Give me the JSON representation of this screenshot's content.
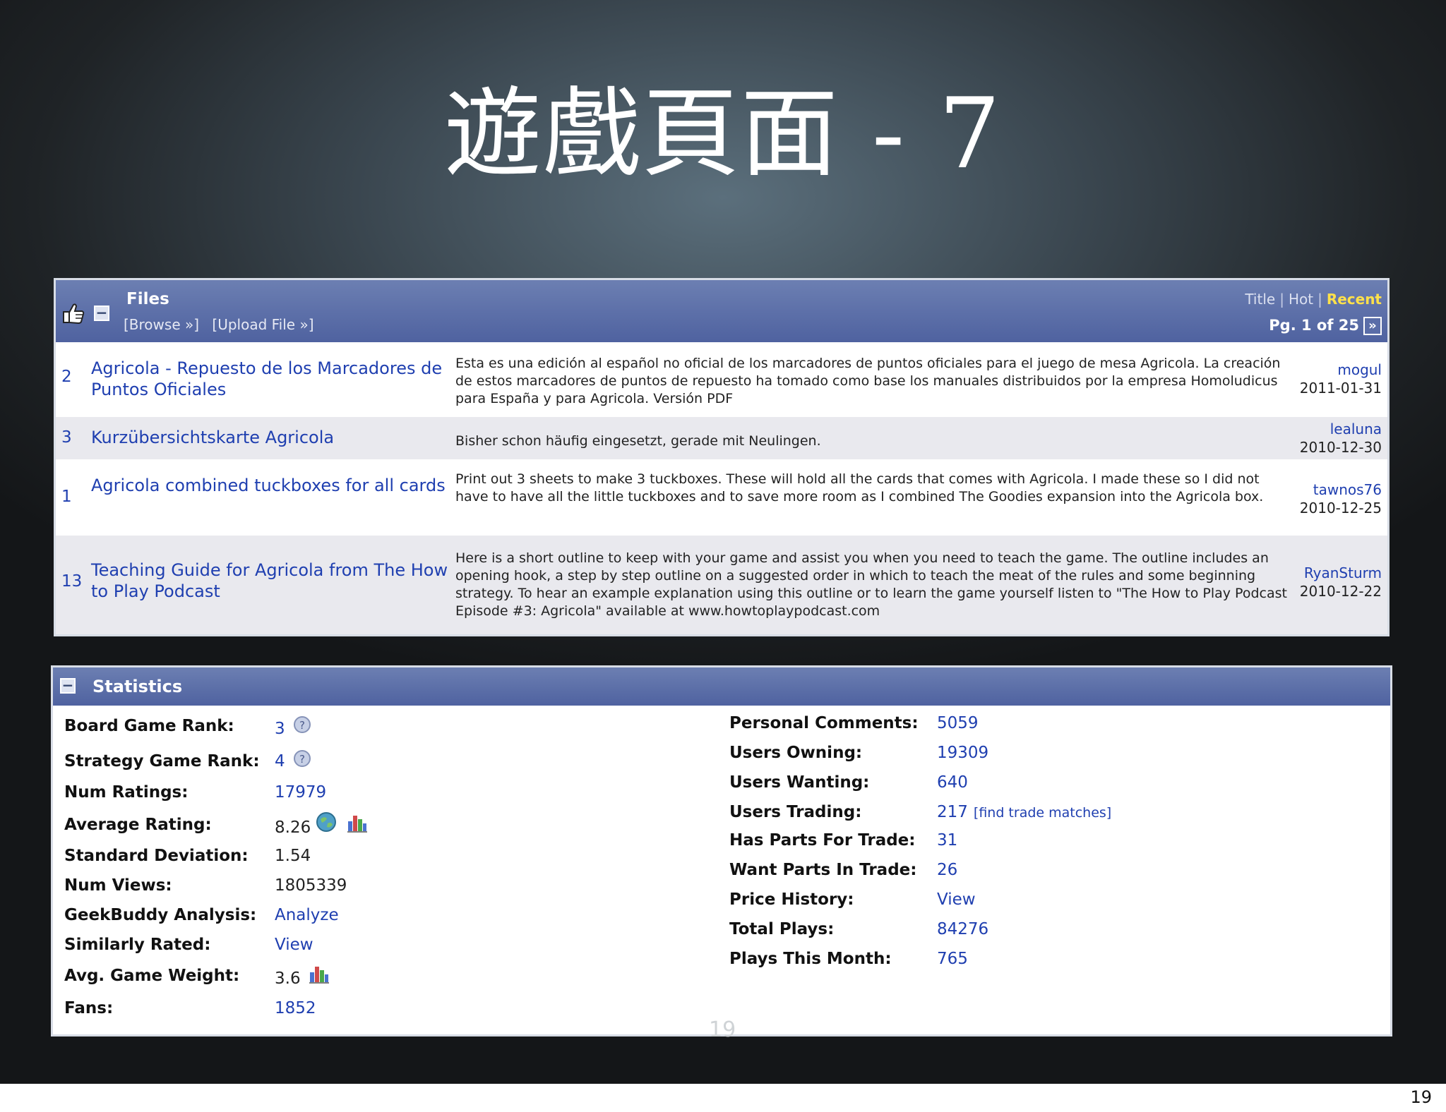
{
  "slide": {
    "title": "遊戲頁面 - 7",
    "page_number": "19",
    "ghost_number": "19"
  },
  "files": {
    "title": "Files",
    "browse_link": "[Browse »]",
    "upload_link": "[Upload File »]",
    "sort": {
      "title": "Title",
      "hot": "Hot",
      "recent": "Recent",
      "active": "Recent"
    },
    "pager": {
      "text": "Pg. 1 of 25",
      "next": "»"
    },
    "rows": [
      {
        "count": "2",
        "name": "Agricola - Repuesto de los Marcadores de Puntos Oficiales",
        "description": "Esta es una edición al español no oficial de los marcadores de puntos oficiales para el juego de mesa Agricola. La creación de estos marcadores de puntos de repuesto ha tomado como base los manuales distribuidos por la empresa Homoludicus para España y para Agricola. Versión PDF",
        "user": "mogul",
        "date": "2011-01-31"
      },
      {
        "count": "3",
        "name": "Kurzübersichtskarte Agricola",
        "description": "Bisher schon häufig eingesetzt, gerade mit Neulingen.",
        "user": "lealuna",
        "date": "2010-12-30"
      },
      {
        "count": "1",
        "name": "Agricola combined tuckboxes for all cards",
        "description": "Print out 3 sheets to make 3 tuckboxes. These will hold all the cards that comes with Agricola. I made these so I did not have to have all the little tuckboxes and to save more room as I combined The Goodies expansion into the Agricola box.",
        "user": "tawnos76",
        "date": "2010-12-25"
      },
      {
        "count": "13",
        "name": "Teaching Guide for Agricola from The How to Play Podcast",
        "description": "Here is a short outline to keep with your game and assist you when you need to teach the game. The outline includes an opening hook, a step by step outline on a suggested order in which to teach the meat of the rules and some beginning strategy. To hear an example explanation using this outline or to learn the game yourself listen to \"The How to Play Podcast Episode #3: Agricola\" available at www.howtoplaypodcast.com",
        "user": "RyanSturm",
        "date": "2010-12-22"
      }
    ]
  },
  "statistics": {
    "title": "Statistics",
    "left": [
      {
        "label": "Board Game Rank:",
        "value": "3"
      },
      {
        "label": "Strategy Game Rank:",
        "value": "4"
      },
      {
        "label": "Num Ratings:",
        "value": "17979"
      },
      {
        "label": "Average Rating:",
        "value": "8.26"
      },
      {
        "label": "Standard Deviation:",
        "value": "1.54"
      },
      {
        "label": "Num Views:",
        "value": "1805339"
      },
      {
        "label": "GeekBuddy Analysis:",
        "value": "Analyze"
      },
      {
        "label": "Similarly Rated:",
        "value": "View"
      },
      {
        "label": "Avg. Game Weight:",
        "value": "3.6"
      },
      {
        "label": "Fans:",
        "value": "1852"
      }
    ],
    "right": [
      {
        "label": "Personal Comments:",
        "value": "5059"
      },
      {
        "label": "Users Owning:",
        "value": "19309"
      },
      {
        "label": "Users Wanting:",
        "value": "640"
      },
      {
        "label": "Users Trading:",
        "value": "217",
        "extra": "[find trade matches]"
      },
      {
        "label": "Has Parts For Trade:",
        "value": "31"
      },
      {
        "label": "Want Parts In Trade:",
        "value": "26"
      },
      {
        "label": "Price History:",
        "value": "View"
      },
      {
        "label": "Total Plays:",
        "value": "84276"
      },
      {
        "label": "Plays This Month:",
        "value": "765"
      }
    ]
  },
  "icons": {
    "thumb": "thumbs-up-icon",
    "collapse": "collapse-icon",
    "info": "info-icon",
    "globe": "globe-icon",
    "chart": "bar-chart-icon"
  },
  "colors": {
    "header_top": "#6c7fb2",
    "header_bottom": "#4f62a0",
    "link": "#1f3fb0",
    "active_sort": "#ffe14a",
    "alt_row": "#e9e9ee"
  }
}
